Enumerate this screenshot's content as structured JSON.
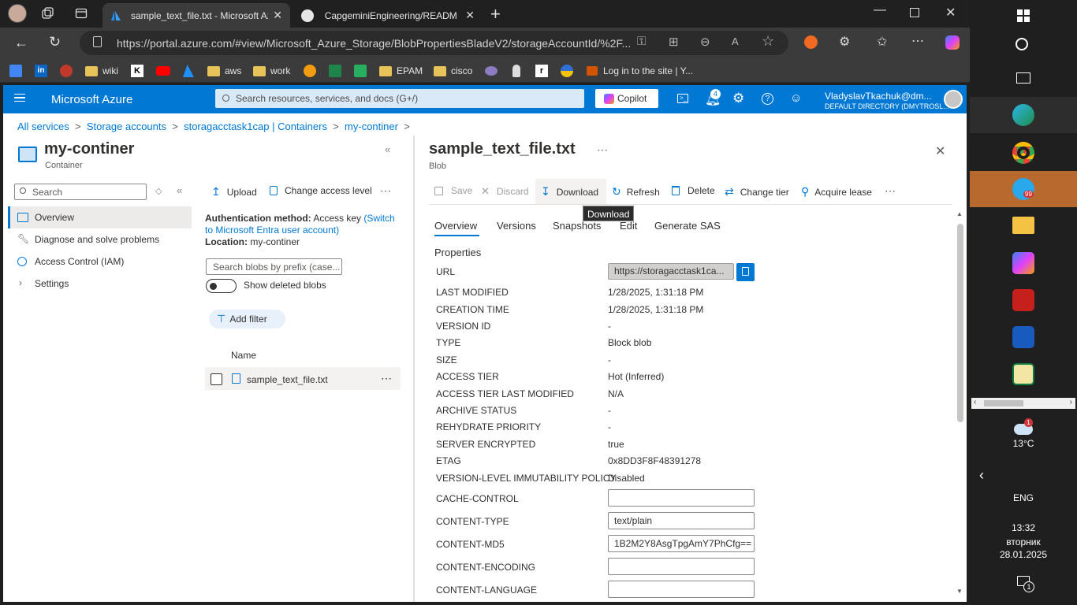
{
  "browser": {
    "tabs": [
      {
        "title": "sample_text_file.txt - Microsoft Az"
      },
      {
        "title": "CapgeminiEngineering/README.m"
      }
    ],
    "url": "https://portal.azure.com/#view/Microsoft_Azure_Storage/BlobPropertiesBladeV2/storageAccountId/%2F...",
    "bookmarks": [
      "wiki",
      "aws",
      "work",
      "EPAM",
      "cisco",
      "Log in to the site | Y..."
    ]
  },
  "azure": {
    "brand": "Microsoft Azure",
    "search_placeholder": "Search resources, services, and docs (G+/)",
    "copilot": "Copilot",
    "notifications_count": "4",
    "user_name": "VladyslavTkachuk@dm...",
    "user_directory": "DEFAULT DIRECTORY (DMYTROSL..."
  },
  "breadcrumb": [
    "All services",
    "Storage accounts",
    "storagacctask1cap | Containers",
    "my-continer"
  ],
  "container": {
    "title": "my-continer",
    "subtitle": "Container",
    "search_placeholder": "Search",
    "nav": [
      {
        "label": "Overview"
      },
      {
        "label": "Diagnose and solve problems"
      },
      {
        "label": "Access Control (IAM)"
      },
      {
        "label": "Settings"
      }
    ],
    "toolbar": {
      "upload": "Upload",
      "change_access": "Change access level"
    },
    "auth_label": "Authentication method:",
    "auth_value": "Access key",
    "auth_link": "(Switch to Microsoft Entra user account)",
    "location_label": "Location:",
    "location_value": "my-continer",
    "blob_search_placeholder": "Search blobs by prefix (case...",
    "show_deleted": "Show deleted blobs",
    "add_filter": "Add filter",
    "col_name": "Name",
    "rows": [
      {
        "name": "sample_text_file.txt"
      }
    ]
  },
  "blob": {
    "title": "sample_text_file.txt",
    "subtitle": "Blob",
    "toolbar": {
      "save": "Save",
      "discard": "Discard",
      "download": "Download",
      "refresh": "Refresh",
      "delete": "Delete",
      "change_tier": "Change tier",
      "acquire_lease": "Acquire lease"
    },
    "tooltip": "Download",
    "tabs": [
      "Overview",
      "Versions",
      "Snapshots",
      "Edit",
      "Generate SAS"
    ],
    "section": "Properties",
    "url_label": "URL",
    "url_value": "https://storagacctask1ca...",
    "props": [
      {
        "k": "LAST MODIFIED",
        "v": "1/28/2025, 1:31:18 PM"
      },
      {
        "k": "CREATION TIME",
        "v": "1/28/2025, 1:31:18 PM"
      },
      {
        "k": "VERSION ID",
        "v": "-"
      },
      {
        "k": "TYPE",
        "v": "Block blob"
      },
      {
        "k": "SIZE",
        "v": "-"
      },
      {
        "k": "ACCESS TIER",
        "v": "Hot (Inferred)"
      },
      {
        "k": "ACCESS TIER LAST MODIFIED",
        "v": "N/A"
      },
      {
        "k": "ARCHIVE STATUS",
        "v": "-"
      },
      {
        "k": "REHYDRATE PRIORITY",
        "v": "-"
      },
      {
        "k": "SERVER ENCRYPTED",
        "v": "true"
      },
      {
        "k": "ETAG",
        "v": "0x8DD3F8F48391278"
      },
      {
        "k": "VERSION-LEVEL IMMUTABILITY POLICY",
        "v": "Disabled"
      }
    ],
    "editable": [
      {
        "k": "CACHE-CONTROL",
        "v": ""
      },
      {
        "k": "CONTENT-TYPE",
        "v": "text/plain"
      },
      {
        "k": "CONTENT-MD5",
        "v": "1B2M2Y8AsgTpgAmY7PhCfg=="
      },
      {
        "k": "CONTENT-ENCODING",
        "v": ""
      },
      {
        "k": "CONTENT-LANGUAGE",
        "v": ""
      }
    ]
  },
  "taskbar": {
    "badge_telegram": "99",
    "weather_badge": "1",
    "temperature": "13°C",
    "lang": "ENG",
    "time": "13:32",
    "day": "вторник",
    "date": "28.01.2025",
    "notif_count": "1"
  }
}
